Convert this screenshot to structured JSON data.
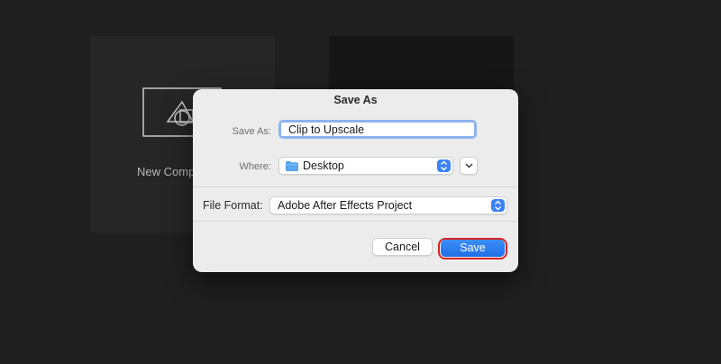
{
  "background": {
    "left_card_label": "New Comp"
  },
  "dialog": {
    "title": "Save As",
    "save_as_label": "Save As:",
    "filename": "Clip to Upscale",
    "where_label": "Where:",
    "where_value": "Desktop",
    "file_format_label": "File Format:",
    "file_format_value": "Adobe After Effects Project",
    "cancel_label": "Cancel",
    "save_label": "Save"
  },
  "colors": {
    "accent": "#3b82f6",
    "highlight": "#d62424",
    "dialog_bg": "#ececec"
  }
}
